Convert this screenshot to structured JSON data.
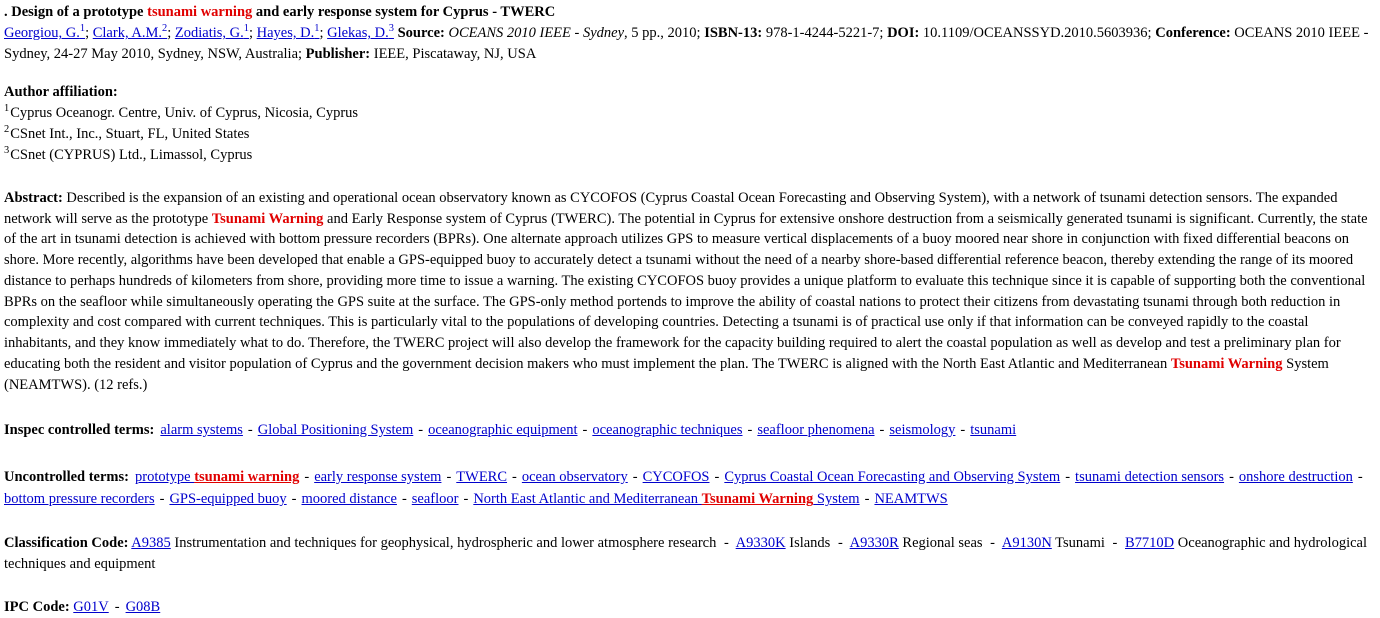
{
  "record": {
    "lead_marker": ".",
    "title_before": "Design of a prototype ",
    "title_highlight": "tsunami warning",
    "title_after": " and early response system for Cyprus - TWERC",
    "authors": [
      {
        "name": "Georgiou, G.",
        "affil": "1"
      },
      {
        "name": "Clark, A.M.",
        "affil": "2"
      },
      {
        "name": "Zodiatis, G.",
        "affil": "1"
      },
      {
        "name": "Hayes, D.",
        "affil": "1"
      },
      {
        "name": "Glekas, D.",
        "affil": "3"
      }
    ],
    "source_label": "Source:",
    "source_value_italic": "OCEANS 2010 IEEE - Sydney",
    "source_value_rest": ", 5 pp., 2010;",
    "isbn_label": "ISBN-13:",
    "isbn_value": "978-1-4244-5221-7;",
    "doi_label": "DOI:",
    "doi_value": "10.1109/OCEANSSYD.2010.5603936;",
    "conference_label": "Conference:",
    "conference_value": "OCEANS 2010 IEEE - Sydney, 24-27 May 2010, Sydney, NSW, Australia;",
    "publisher_label": "Publisher:",
    "publisher_value": "IEEE, Piscataway, NJ, USA"
  },
  "affiliation": {
    "label": "Author affiliation:",
    "entries": [
      {
        "marker": "1",
        "text": "Cyprus Oceanogr. Centre, Univ. of Cyprus, Nicosia, Cyprus"
      },
      {
        "marker": "2",
        "text": "CSnet Int., Inc., Stuart, FL, United States"
      },
      {
        "marker": "3",
        "text": "CSnet (CYPRUS) Ltd., Limassol, Cyprus"
      }
    ]
  },
  "abstract": {
    "label": "Abstract:",
    "part1": " Described is the expansion of an existing and operational ocean observatory known as CYCOFOS (Cyprus Coastal Ocean Forecasting and Observing System), with a network of tsunami detection sensors. The expanded network will serve as the prototype ",
    "hl1": "Tsunami Warning",
    "part2": " and Early Response system of Cyprus (TWERC). The potential in Cyprus for extensive onshore destruction from a seismically generated tsunami is significant. Currently, the state of the art in tsunami detection is achieved with bottom pressure recorders (BPRs). One alternate approach utilizes GPS to measure vertical displacements of a buoy moored near shore in conjunction with fixed differential beacons on shore. More recently, algorithms have been developed that enable a GPS-equipped buoy to accurately detect a tsunami without the need of a nearby shore-based differential reference beacon, thereby extending the range of its moored distance to perhaps hundreds of kilometers from shore, providing more time to issue a warning. The existing CYCOFOS buoy provides a unique platform to evaluate this technique since it is capable of supporting both the conventional BPRs on the seafloor while simultaneously operating the GPS suite at the surface. The GPS-only method portends to improve the ability of coastal nations to protect their citizens from devastating tsunami through both reduction in complexity and cost compared with current techniques. This is particularly vital to the populations of developing countries. Detecting a tsunami is of practical use only if that information can be conveyed rapidly to the coastal inhabitants, and they know immediately what to do. Therefore, the TWERC project will also develop the framework for the capacity building required to alert the coastal population as well as develop and test a preliminary plan for educating both the resident and visitor population of Cyprus and the government decision makers who must implement the plan. The TWERC is aligned with the North East Atlantic and Mediterranean ",
    "hl2": "Tsunami Warning",
    "part3": " System (NEAMTWS). (12 refs.)"
  },
  "inspec_terms": {
    "label": "Inspec controlled terms:",
    "items": [
      "alarm systems",
      "Global Positioning System",
      "oceanographic equipment",
      "oceanographic techniques",
      "seafloor phenomena",
      "seismology",
      "tsunami"
    ]
  },
  "uncontrolled_terms": {
    "label": "Uncontrolled terms:",
    "items": [
      {
        "pre": "prototype ",
        "hl": "tsunami warning",
        "post": ""
      },
      {
        "pre": "early response system",
        "hl": "",
        "post": ""
      },
      {
        "pre": "TWERC",
        "hl": "",
        "post": ""
      },
      {
        "pre": "ocean observatory",
        "hl": "",
        "post": ""
      },
      {
        "pre": "CYCOFOS",
        "hl": "",
        "post": ""
      },
      {
        "pre": "Cyprus Coastal Ocean Forecasting and Observing System",
        "hl": "",
        "post": ""
      },
      {
        "pre": "tsunami detection sensors",
        "hl": "",
        "post": ""
      },
      {
        "pre": "onshore destruction",
        "hl": "",
        "post": ""
      },
      {
        "pre": "bottom pressure recorders",
        "hl": "",
        "post": ""
      },
      {
        "pre": "GPS-equipped buoy",
        "hl": "",
        "post": ""
      },
      {
        "pre": "moored distance",
        "hl": "",
        "post": ""
      },
      {
        "pre": "seafloor",
        "hl": "",
        "post": ""
      },
      {
        "pre": "North East Atlantic and Mediterranean ",
        "hl": "Tsunami Warning",
        "post": " System"
      },
      {
        "pre": "NEAMTWS",
        "hl": "",
        "post": ""
      }
    ]
  },
  "classification": {
    "label": "Classification Code:",
    "entries": [
      {
        "code": "A9385",
        "desc": "Instrumentation and techniques for geophysical, hydrospheric and lower atmosphere research"
      },
      {
        "code": "A9330K",
        "desc": "Islands"
      },
      {
        "code": "A9330R",
        "desc": "Regional seas"
      },
      {
        "code": "A9130N",
        "desc": "Tsunami"
      },
      {
        "code": "B7710D",
        "desc": "Oceanographic and hydrological techniques and equipment"
      }
    ]
  },
  "ipc": {
    "label": "IPC Code:",
    "codes": [
      "G01V",
      "G08B"
    ]
  },
  "colors": {
    "link": "#0000cc",
    "highlight": "#e00000",
    "text": "#000000",
    "background": "#ffffff"
  }
}
